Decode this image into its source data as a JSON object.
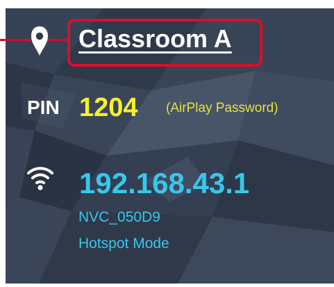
{
  "location": {
    "name": "Classroom A",
    "icon": "location-pin-icon"
  },
  "pin": {
    "label": "PIN",
    "code": "1204",
    "hint": "(AirPlay Password)"
  },
  "network": {
    "icon": "wifi-icon",
    "ip_address": "192.168.43.1",
    "ssid": "NVC_050D9",
    "mode": "Hotspot Mode"
  },
  "colors": {
    "panel_background": "#2f3a4b",
    "callout_red": "#d90f2a",
    "pin_yellow": "#f7f22b",
    "network_cyan": "#39c7eb",
    "text_white": "#ffffff"
  }
}
